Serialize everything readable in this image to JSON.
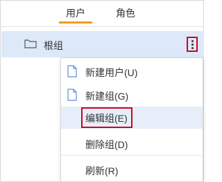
{
  "tabs": [
    {
      "label": "用户",
      "active": true
    },
    {
      "label": "角色",
      "active": false
    }
  ],
  "colors": {
    "accent_underline": "#f39c12",
    "selected_row": "#dde9f8",
    "highlight_border": "#d0021b",
    "icon_blue": "#5b8ed6"
  },
  "tree": {
    "root_label": "根组",
    "icon": "folder-icon",
    "more_icon": "vertical-ellipsis-icon"
  },
  "menu": {
    "items": [
      {
        "label": "新建用户(U)",
        "icon": "document-icon"
      },
      {
        "label": "新建组(G)",
        "icon": "document-icon"
      },
      {
        "label": "编辑组(E)",
        "highlighted": true
      },
      {
        "label": "删除组(D)"
      },
      {
        "label": "刷新(R)"
      }
    ]
  }
}
